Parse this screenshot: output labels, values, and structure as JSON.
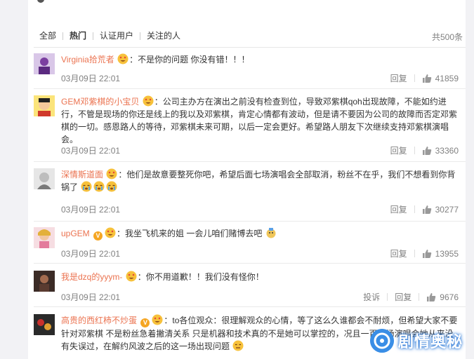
{
  "tabs": [
    {
      "label": "全部",
      "active": false
    },
    {
      "label": "热门",
      "active": true
    },
    {
      "label": "认证用户",
      "active": false
    },
    {
      "label": "关注的人",
      "active": false
    }
  ],
  "total_count": "共500条",
  "actions": {
    "reply": "回复",
    "report": "投诉"
  },
  "comments": [
    {
      "username": "Virginia拾荒者",
      "colon": "：",
      "text": "不是你的问题 你没有错！！！",
      "time": "03月09日 22:01",
      "likes": "41859",
      "avatar_color": "#7b3fa0"
    },
    {
      "username": "GEM邓紫棋的小宝贝",
      "colon": "：",
      "text": "公司主办方在演出之前没有检查到位，导致邓紫棋qoh出现故障，不能如约进行，不管是现场的你还是线上的我以及邓紫棋，肯定心情都有波动，但是请不要因为公司的故障而否定邓紫棋的一切。感恩路人的等待，邓紫棋未来可期，以后一定会更好。希望路人朋友下次继续支持邓紫棋演唱会。",
      "time": "03月09日 22:01",
      "likes": "33360",
      "avatar_color": "#f3d23a"
    },
    {
      "username": "深情斯道面",
      "colon": "：",
      "text": "他们是故意要整死你吧，希望后面七场演唱会全部取消，粉丝不在乎，我们不想看到你背锅了",
      "time": "03月09日 22:01",
      "likes": "30277",
      "avatar_color": "#9a9a9a"
    },
    {
      "username": "upGEM",
      "colon": "：",
      "text": "我坐飞机来的姐 一会儿咱们赌博去吧",
      "time": "03月09日 22:01",
      "likes": "13955",
      "avatar_color": "#e8a6b0"
    },
    {
      "username": "我是dzq的yyym-",
      "colon": "：",
      "text": "你不用道歉！！我们没有怪你！",
      "time": "03月09日 22:01",
      "likes": "9676",
      "avatar_color": "#3b2b26"
    },
    {
      "username": "高贵的西红柿不炒蛋",
      "colon": "：",
      "text": "to各位观众：很理解观众的心情，等了这么久谁都会不耐烦，但希望大家不要针对邓紫棋 不是粉丝急着撇清关系 只是机器和技术真的不是她可以掌控的，况且一百多场演唱会她从来没有失误过，在解约风波之后的这一场出现问题",
      "time": "",
      "likes": "",
      "avatar_color": "#2a2a2a"
    }
  ],
  "watermark": {
    "text": "剧情奥秘"
  },
  "colors": {
    "username": "#eb7350",
    "emoji": "#f7c13b",
    "link_gray": "#808080"
  }
}
